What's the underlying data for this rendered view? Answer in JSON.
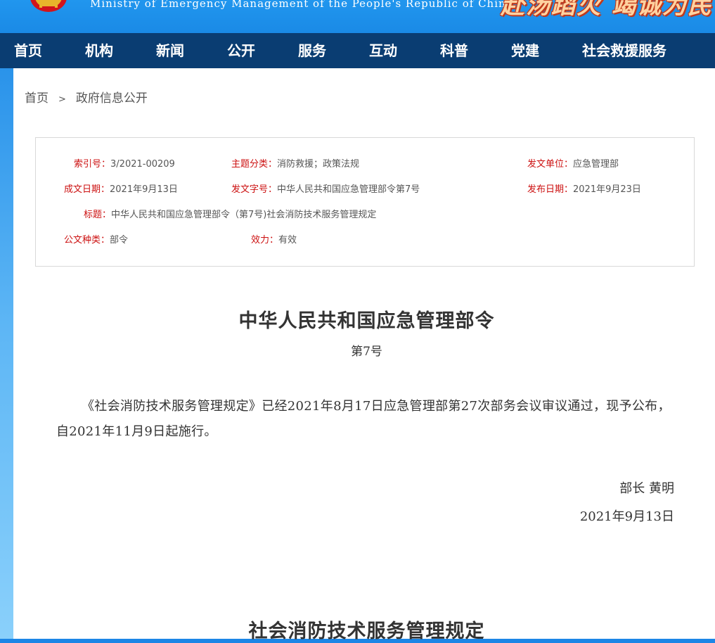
{
  "header": {
    "ministry_en": "Ministry of Emergency Management of the People's Republic of China",
    "slogan": "赴汤蹈火 竭诚为民"
  },
  "nav": {
    "items": [
      "首页",
      "机构",
      "新闻",
      "公开",
      "服务",
      "互动",
      "科普",
      "党建",
      "社会救援服务"
    ]
  },
  "breadcrumb": {
    "home": "首页",
    "separator": ">",
    "current": "政府信息公开"
  },
  "meta": {
    "index_label": "索引号：",
    "index_value": "3/2021-00209",
    "topic_label": "主题分类：",
    "topic_value": "消防救援；政策法规",
    "issuer_label": "发文单位：",
    "issuer_value": "应急管理部",
    "created_label": "成文日期：",
    "created_value": "2021年9月13日",
    "docno_label": "发文字号：",
    "docno_value": "中华人民共和国应急管理部令第7号",
    "published_label": "发布日期：",
    "published_value": "2021年9月23日",
    "title_label": "标题：",
    "title_value": "中华人民共和国应急管理部令（第7号)社会消防技术服务管理规定",
    "type_label": "公文种类：",
    "type_value": "部令",
    "validity_label": "效力：",
    "validity_value": "有效"
  },
  "document": {
    "title": "中华人民共和国应急管理部令",
    "number": "第7号",
    "body": "《社会消防技术服务管理规定》已经2021年8月17日应急管理部第27次部务会议审议通过，现予公布，自2021年11月9日起施行。",
    "signer": "部长  黄明",
    "date": "2021年9月13日",
    "subtitle": "社会消防技术服务管理规定"
  },
  "colors": {
    "header_blue": "#1c86e6",
    "nav_navy": "#0a3d72",
    "label_red": "#cc1010",
    "slogan": "#ffd2a0"
  }
}
